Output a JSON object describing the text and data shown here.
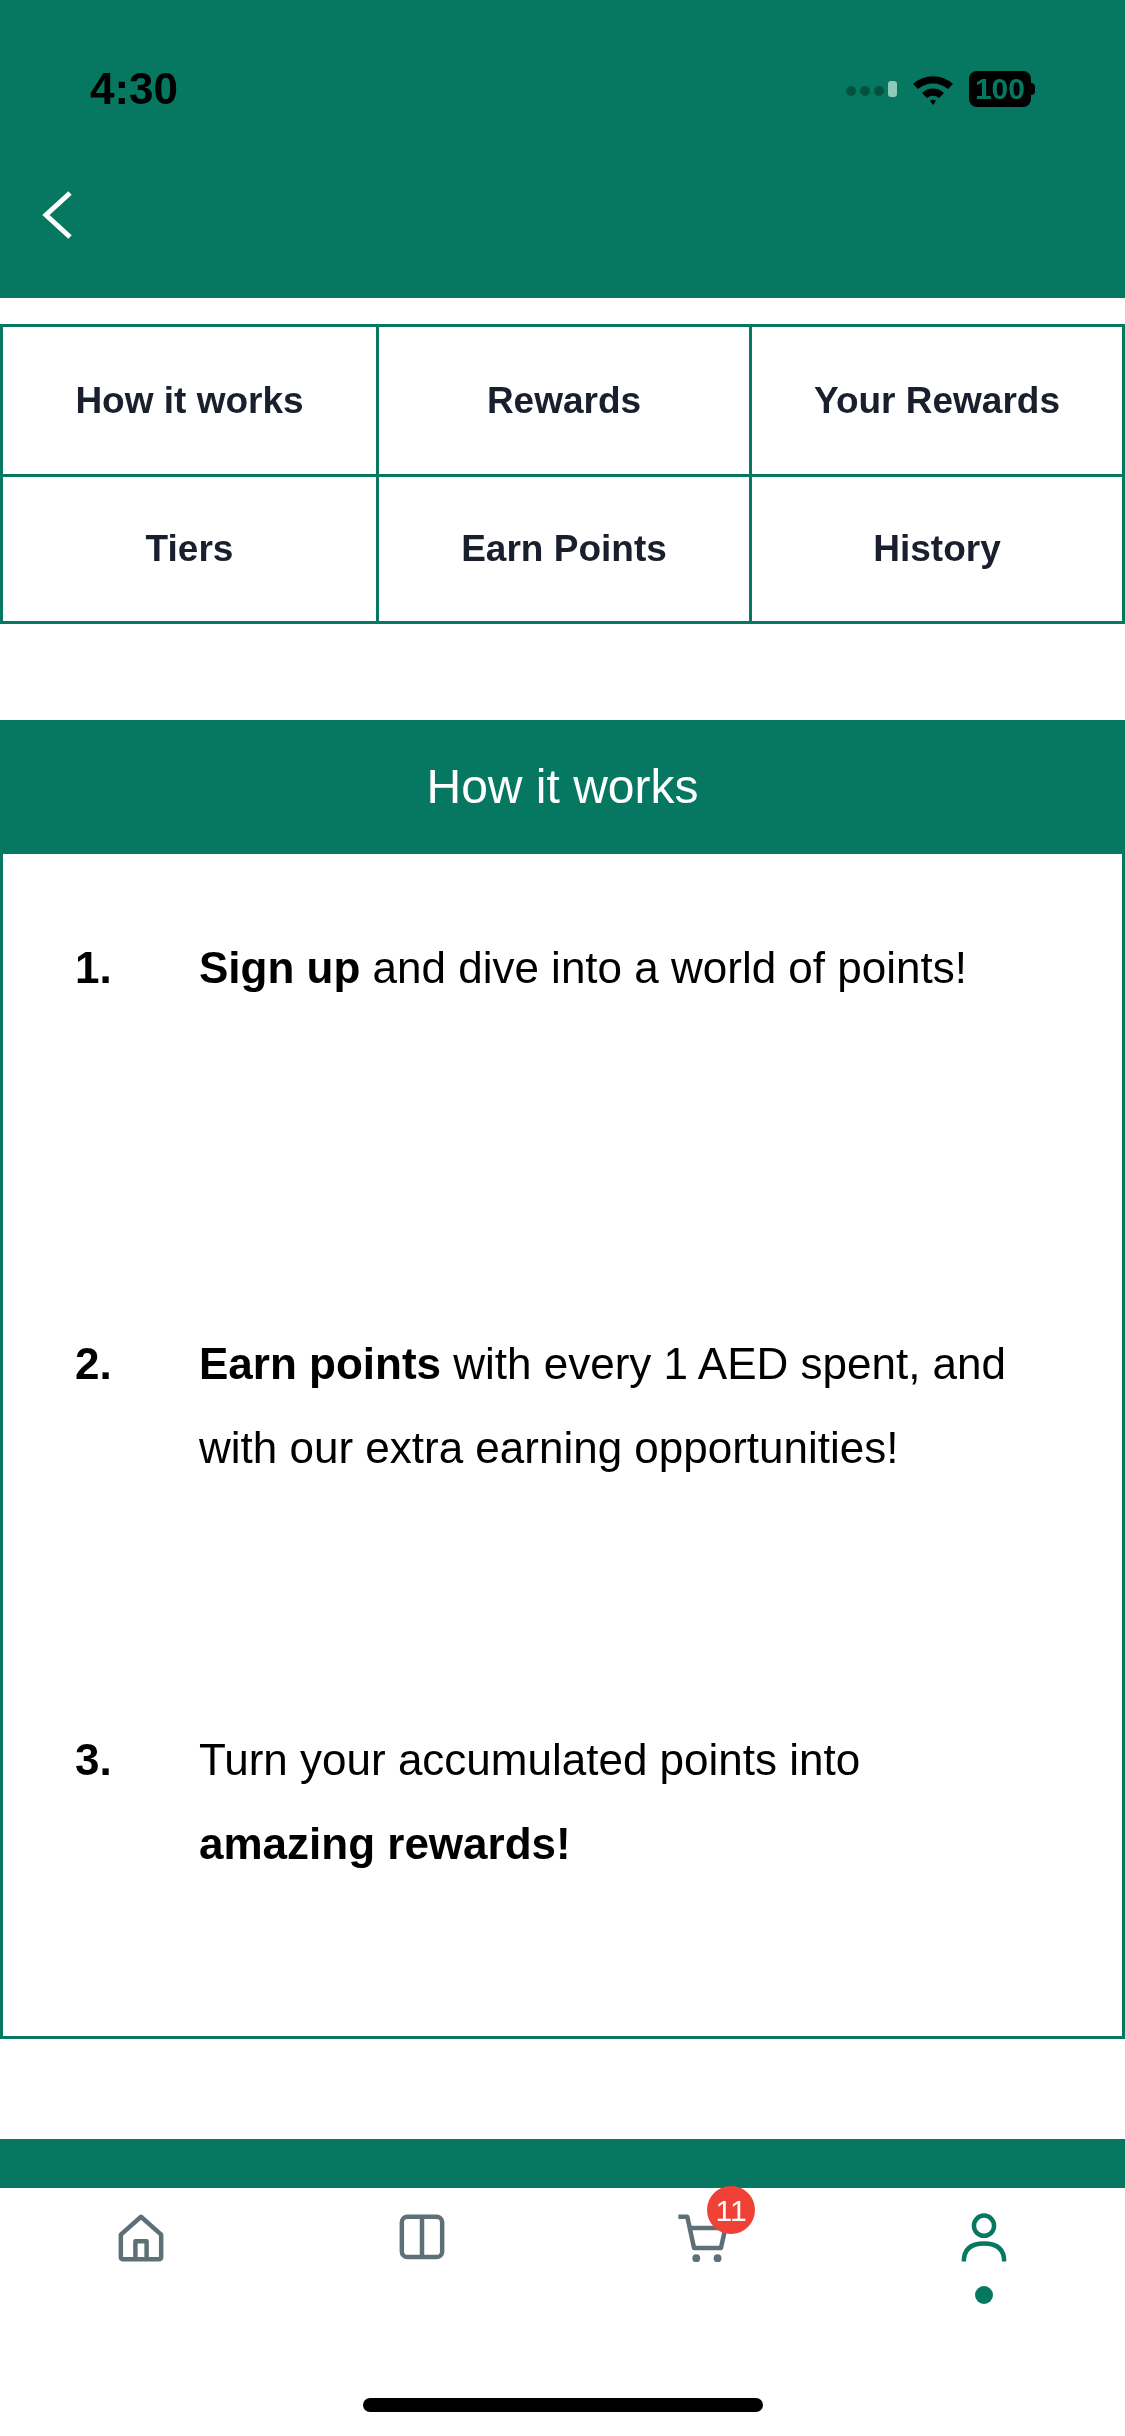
{
  "status_bar": {
    "time": "4:30",
    "battery": "100"
  },
  "tabs": [
    {
      "label": "How it works"
    },
    {
      "label": "Rewards"
    },
    {
      "label": "Your Rewards"
    },
    {
      "label": "Tiers"
    },
    {
      "label": "Earn Points"
    },
    {
      "label": "History"
    }
  ],
  "section": {
    "title": "How it works",
    "steps": [
      {
        "number": "1.",
        "text": "**Sign up** and dive into a world of points!"
      },
      {
        "number": "2.",
        "text": "**Earn points** with every 1 AED spent, and with our extra earning opportunities!"
      },
      {
        "number": "3.",
        "text": "Turn your accumulated points into **amazing rewards!**"
      }
    ]
  },
  "bottom_nav": [
    {
      "kind": "home",
      "selected": false
    },
    {
      "kind": "catalog",
      "selected": false
    },
    {
      "kind": "cart",
      "selected": false,
      "badge": "11"
    },
    {
      "kind": "profile",
      "selected": true
    }
  ]
}
